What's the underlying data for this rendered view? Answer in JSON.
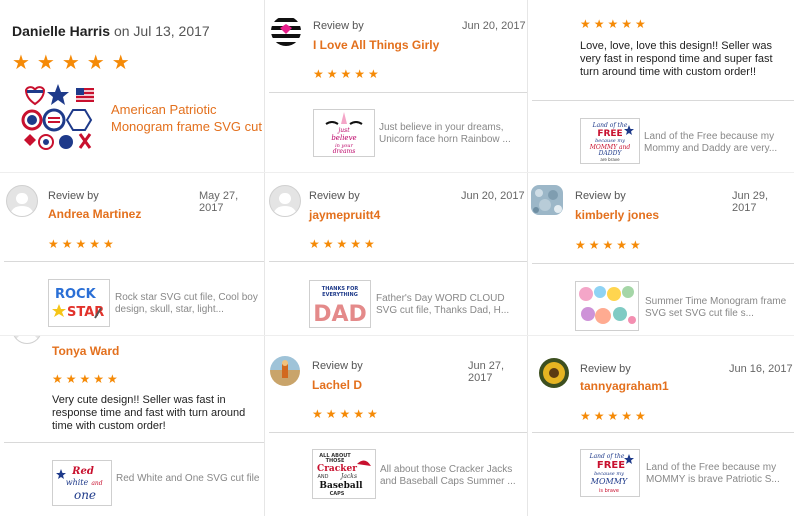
{
  "featured": {
    "reviewer": "Danielle Harris",
    "date_prefix": "on Jul 13, 2017",
    "stars": "★★★★★",
    "product_title": "American Patriotic Monogram frame SVG cut file for silh"
  },
  "cards": [
    {
      "id": "c2",
      "review_by": "Review by",
      "name": "I Love All Things Girly",
      "date": "Jun 20, 2017",
      "stars": "★★★★★",
      "product": "Just believe in your dreams, Unicorn face horn Rainbow ...",
      "avatar": "stripes-pink-icon"
    },
    {
      "id": "c3",
      "review_by": "",
      "name": "",
      "date": "",
      "stars": "★★★★★",
      "text": "Love, love, love this design!! Seller was very fast in respond time and super fast turn around time with custom order!!",
      "product": "Land of the Free because my Mommy and Daddy are very..."
    },
    {
      "id": "c4",
      "review_by": "Review by",
      "name": "Andrea Martinez",
      "date": "May 27, 2017",
      "stars": "★★★★★",
      "product": "Rock star SVG cut file, Cool boy design, skull, star, light...",
      "avatar": "default-user-icon"
    },
    {
      "id": "c5",
      "review_by": "Review by",
      "name": "jaymepruitt4",
      "date": "Jun 20, 2017",
      "stars": "★★★★★",
      "product": "Father's Day WORD CLOUD SVG cut file, Thanks Dad, H...",
      "avatar": "default-user-icon"
    },
    {
      "id": "c6",
      "review_by": "Review by",
      "name": "kimberly jones",
      "date": "Jun 29, 2017",
      "stars": "★★★★★",
      "product": "Summer Time Monogram frame SVG set SVG cut file s...",
      "avatar": "glitter-photo-icon"
    },
    {
      "id": "c7",
      "review_by": "",
      "name": "Tonya Ward",
      "date": "",
      "stars": "★★★★★",
      "text": "Very cute design!! Seller was fast in response time and fast with turn around time with custom order!",
      "product": "Red White and One SVG cut file"
    },
    {
      "id": "c8",
      "review_by": "Review by",
      "name": "Lachel D",
      "date": "Jun 27, 2017",
      "stars": "★★★★★",
      "product": "All about those Cracker Jacks and Baseball Caps Summer ...",
      "avatar": "beach-photo-icon"
    },
    {
      "id": "c9",
      "review_by": "Review by",
      "name": "tannyagraham1",
      "date": "Jun 16, 2017",
      "stars": "★★★★★",
      "product": "Land of the Free because my MOMMY is brave Patriotic S...",
      "avatar": "sunflower-photo-icon"
    }
  ],
  "thumbs": {
    "unicorn": {
      "l1": "just",
      "l2": "believe",
      "l3": "in your",
      "l4": "dreams"
    },
    "land1": {
      "l1": "Land of the",
      "l2": "FREE",
      "l3": "because my",
      "l4": "MOMMY and",
      "l5": "DADDY",
      "l6": "are brave"
    },
    "rock": {
      "l1": "ROCK",
      "l2": "STAR"
    },
    "dad": {
      "l1": "THANKS FOR",
      "l2": "EVERYTHING",
      "l3": "DAD"
    },
    "redwhite": {
      "l1": "Red",
      "l2": "white",
      "l3": "and",
      "l4": "one"
    },
    "cracker": {
      "l1": "ALL ABOUT",
      "l2": "THOSE",
      "l3": "Cracker",
      "l4": "Jacks",
      "l5": "AND",
      "l6": "Baseball",
      "l7": "CAPS"
    },
    "land2": {
      "l1": "Land of the",
      "l2": "FREE",
      "l3": "because my",
      "l4": "MOMMY",
      "l5": "is brave"
    }
  },
  "colors": {
    "accent": "#e3701d",
    "star": "#f58a07",
    "divider": "#d9d9d9"
  }
}
